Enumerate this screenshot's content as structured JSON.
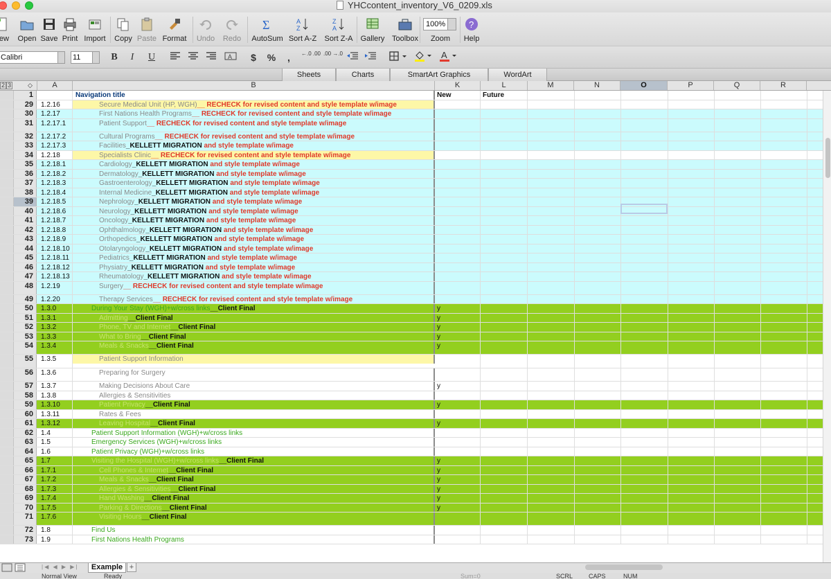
{
  "window": {
    "title": "YHCcontent_inventory_V6_0209.xls"
  },
  "toolbar": {
    "items": [
      {
        "label": "New",
        "icon": "new-doc-icon"
      },
      {
        "label": "Open",
        "icon": "open-folder-icon"
      },
      {
        "label": "Save",
        "icon": "save-icon"
      },
      {
        "label": "Print",
        "icon": "print-icon"
      },
      {
        "label": "Import",
        "icon": "import-icon"
      },
      {
        "label": "Copy",
        "icon": "copy-icon"
      },
      {
        "label": "Paste",
        "icon": "paste-icon"
      },
      {
        "label": "Format",
        "icon": "format-brush-icon"
      },
      {
        "label": "Undo",
        "icon": "undo-icon"
      },
      {
        "label": "Redo",
        "icon": "redo-icon"
      },
      {
        "label": "AutoSum",
        "icon": "sigma-icon"
      },
      {
        "label": "Sort A-Z",
        "icon": "sort-az-icon"
      },
      {
        "label": "Sort Z-A",
        "icon": "sort-za-icon"
      },
      {
        "label": "Gallery",
        "icon": "gallery-icon"
      },
      {
        "label": "Toolbox",
        "icon": "toolbox-icon"
      },
      {
        "label": "Zoom",
        "icon": "zoom-icon"
      },
      {
        "label": "Help",
        "icon": "help-icon"
      }
    ],
    "zoom_value": "100%"
  },
  "formatbar": {
    "font_name": "Calibri",
    "font_size": "11",
    "bold": "B",
    "italic": "I",
    "underline": "U",
    "currency": "$",
    "percent": "%",
    "comma": ",",
    "inc_decimal": "←.0 .00",
    "dec_decimal": ".00 →.0"
  },
  "ribbon": {
    "tabs": [
      "Sheets",
      "Charts",
      "SmartArt Graphics",
      "WordArt"
    ]
  },
  "columns": {
    "outline": [
      "2",
      "3"
    ],
    "letters": [
      "A",
      "B",
      "K",
      "L",
      "M",
      "N",
      "O",
      "P",
      "Q",
      "R"
    ],
    "selected": "O"
  },
  "rows": [
    {
      "n": "1",
      "a": "",
      "segs": [
        {
          "t": "Navigation title",
          "c": "bl"
        }
      ],
      "k": "New",
      "l": "Future",
      "hdr": true
    },
    {
      "n": "29",
      "a": "1.2.16",
      "segs": [
        {
          "t": "Secure Medical Unit (HP, WGH)",
          "c": "gray"
        },
        {
          "t": "__ RECHECK for revised content and style template w/image",
          "c": "red"
        }
      ],
      "k": "",
      "bg": "yellow"
    },
    {
      "n": "30",
      "a": "1.2.17",
      "segs": [
        {
          "t": "First Nations Health Programs",
          "c": "gray"
        },
        {
          "t": "__ RECHECK for revised content and style template w/image",
          "c": "red"
        }
      ],
      "k": "",
      "bg": "cyan"
    },
    {
      "n": "31",
      "a": "1.2.17.1",
      "segs": [
        {
          "t": "Patient Support",
          "c": "gray"
        },
        {
          "t": "__ RECHECK for revised content and style template w/image",
          "c": "red"
        }
      ],
      "k": "",
      "bg": "cyan"
    },
    {
      "n": "32",
      "a": "1.2.17.2",
      "segs": [
        {
          "t": "Cultural Programs",
          "c": "gray"
        },
        {
          "t": "__ RECHECK for revised content and style template w/image",
          "c": "red"
        }
      ],
      "k": "",
      "bg": "cyan"
    },
    {
      "n": "33",
      "a": "1.2.17.3",
      "segs": [
        {
          "t": "Facilities",
          "c": "gray"
        },
        {
          "t": "_KELLETT MIGRATION ",
          "c": "blk"
        },
        {
          "t": "and style template w/image",
          "c": "red"
        }
      ],
      "k": "",
      "bg": "cyan"
    },
    {
      "n": "34",
      "a": "1.2.18",
      "segs": [
        {
          "t": "Specialists Clinic",
          "c": "gray"
        },
        {
          "t": "__ RECHECK for revised content and style template w/image",
          "c": "red"
        }
      ],
      "k": "",
      "bg": "yellow"
    },
    {
      "n": "35",
      "a": "1.2.18.1",
      "segs": [
        {
          "t": "Cardiology",
          "c": "gray"
        },
        {
          "t": "_KELLETT MIGRATION ",
          "c": "blk"
        },
        {
          "t": "and style template w/image",
          "c": "red"
        }
      ],
      "k": "",
      "bg": "cyan"
    },
    {
      "n": "36",
      "a": "1.2.18.2",
      "segs": [
        {
          "t": "Dermatology",
          "c": "gray"
        },
        {
          "t": "_KELLETT MIGRATION ",
          "c": "blk"
        },
        {
          "t": "and style template w/image",
          "c": "red"
        }
      ],
      "k": "",
      "bg": "cyan"
    },
    {
      "n": "37",
      "a": "1.2.18.3",
      "segs": [
        {
          "t": "Gastroenterology",
          "c": "gray"
        },
        {
          "t": "_KELLETT MIGRATION ",
          "c": "blk"
        },
        {
          "t": "and style template w/image",
          "c": "red"
        }
      ],
      "k": "",
      "bg": "cyan"
    },
    {
      "n": "38",
      "a": "1.2.18.4",
      "segs": [
        {
          "t": "Internal Medicine",
          "c": "gray"
        },
        {
          "t": "_KELLETT MIGRATION ",
          "c": "blk"
        },
        {
          "t": "and style template w/image",
          "c": "red"
        }
      ],
      "k": "",
      "bg": "cyan"
    },
    {
      "n": "39",
      "a": "1.2.18.5",
      "segs": [
        {
          "t": "Nephrology",
          "c": "gray"
        },
        {
          "t": "_KELLETT MIGRATION ",
          "c": "blk"
        },
        {
          "t": "and style template w/image",
          "c": "red"
        }
      ],
      "k": "",
      "bg": "cyan",
      "sel": true
    },
    {
      "n": "40",
      "a": "1.2.18.6",
      "segs": [
        {
          "t": "Neurology",
          "c": "gray"
        },
        {
          "t": "_KELLETT MIGRATION ",
          "c": "blk"
        },
        {
          "t": "and style template w/image",
          "c": "red"
        }
      ],
      "k": "",
      "bg": "cyan"
    },
    {
      "n": "41",
      "a": "1.2.18.7",
      "segs": [
        {
          "t": "Oncology",
          "c": "gray"
        },
        {
          "t": "_KELLETT MIGRATION ",
          "c": "blk"
        },
        {
          "t": "and style template w/image",
          "c": "red"
        }
      ],
      "k": "",
      "bg": "cyan"
    },
    {
      "n": "42",
      "a": "1.2.18.8",
      "segs": [
        {
          "t": "Ophthalmology",
          "c": "gray"
        },
        {
          "t": "_KELLETT MIGRATION ",
          "c": "blk"
        },
        {
          "t": "and style template w/image",
          "c": "red"
        }
      ],
      "k": "",
      "bg": "cyan"
    },
    {
      "n": "43",
      "a": "1.2.18.9",
      "segs": [
        {
          "t": "Orthopedics",
          "c": "gray"
        },
        {
          "t": "_KELLETT MIGRATION ",
          "c": "blk"
        },
        {
          "t": "and style template w/image",
          "c": "red"
        }
      ],
      "k": "",
      "bg": "cyan"
    },
    {
      "n": "44",
      "a": "1.2.18.10",
      "segs": [
        {
          "t": "Otolaryngology",
          "c": "gray"
        },
        {
          "t": "_KELLETT MIGRATION ",
          "c": "blk"
        },
        {
          "t": "and style template w/image",
          "c": "red"
        }
      ],
      "k": "",
      "bg": "cyan"
    },
    {
      "n": "45",
      "a": "1.2.18.11",
      "segs": [
        {
          "t": "Pediatrics",
          "c": "gray"
        },
        {
          "t": "_KELLETT MIGRATION ",
          "c": "blk"
        },
        {
          "t": "and style template w/image",
          "c": "red"
        }
      ],
      "k": "",
      "bg": "cyan"
    },
    {
      "n": "46",
      "a": "1.2.18.12",
      "segs": [
        {
          "t": "Physiatry",
          "c": "gray"
        },
        {
          "t": "_KELLETT MIGRATION ",
          "c": "blk"
        },
        {
          "t": "and style template w/image",
          "c": "red"
        }
      ],
      "k": "",
      "bg": "cyan"
    },
    {
      "n": "47",
      "a": "1.2.18.13",
      "segs": [
        {
          "t": "Rheumatology",
          "c": "gray"
        },
        {
          "t": "_KELLETT MIGRATION ",
          "c": "blk"
        },
        {
          "t": "and style template w/image",
          "c": "red"
        }
      ],
      "k": "",
      "bg": "cyan"
    },
    {
      "n": "48",
      "a": "1.2.19",
      "segs": [
        {
          "t": "Surgery",
          "c": "gray"
        },
        {
          "t": "__ RECHECK for revised content and style template w/image",
          "c": "red"
        }
      ],
      "k": "",
      "bg": "cyan"
    },
    {
      "n": "49",
      "a": "1.2.20",
      "segs": [
        {
          "t": "Therapy Services",
          "c": "gray"
        },
        {
          "t": "__ RECHECK for revised content and style template w/image",
          "c": "red"
        }
      ],
      "k": "",
      "bg": "cyan"
    },
    {
      "n": "50",
      "a": "1.3.0",
      "segs": [
        {
          "t": "During Your Stay  (WGH)+w/cross links",
          "c": "grn"
        },
        {
          "t": "__Client Final",
          "c": "blk"
        }
      ],
      "k": "y",
      "bg": "green",
      "lvl": 2
    },
    {
      "n": "51",
      "a": "1.3.1",
      "segs": [
        {
          "t": "Admitting",
          "c": "lgrn"
        },
        {
          "t": "__Client Final",
          "c": "blk"
        }
      ],
      "k": "y",
      "bg": "green"
    },
    {
      "n": "52",
      "a": "1.3.2",
      "segs": [
        {
          "t": "Phone, TV and Internet",
          "c": "lgrn"
        },
        {
          "t": "__Client Final",
          "c": "blk"
        }
      ],
      "k": "y",
      "bg": "green"
    },
    {
      "n": "53",
      "a": "1.3.3",
      "segs": [
        {
          "t": "What to Bring",
          "c": "lgrn"
        },
        {
          "t": "__Client Final",
          "c": "blk"
        }
      ],
      "k": "y",
      "bg": "green"
    },
    {
      "n": "54",
      "a": "1.3.4",
      "segs": [
        {
          "t": "Meals & Snacks",
          "c": "lgrn"
        },
        {
          "t": "__Client Final",
          "c": "blk"
        }
      ],
      "k": "y",
      "bg": "green"
    },
    {
      "n": "55",
      "a": "1.3.5",
      "segs": [
        {
          "t": "Patient Support Information",
          "c": "gray"
        }
      ],
      "k": "",
      "bg": "yellowB"
    },
    {
      "n": "56",
      "a": "1.3.6",
      "segs": [
        {
          "t": "Preparing for Surgery",
          "c": "gray"
        }
      ],
      "k": "",
      "bg": "white"
    },
    {
      "n": "57",
      "a": "1.3.7",
      "segs": [
        {
          "t": "Making Decisions About Care",
          "c": "gray"
        }
      ],
      "k": "y",
      "bg": "white"
    },
    {
      "n": "58",
      "a": "1.3.8",
      "segs": [
        {
          "t": "Allergies & Sensitivities",
          "c": "gray"
        }
      ],
      "k": "",
      "bg": "white"
    },
    {
      "n": "59",
      "a": "1.3.10",
      "segs": [
        {
          "t": "Patient Privacy",
          "c": "lgrn"
        },
        {
          "t": "__Client Final",
          "c": "blk"
        }
      ],
      "k": "y",
      "bg": "green"
    },
    {
      "n": "60",
      "a": "1.3.11",
      "segs": [
        {
          "t": "Rates & Fees",
          "c": "gray"
        }
      ],
      "k": "",
      "bg": "white"
    },
    {
      "n": "61",
      "a": "1.3.12",
      "segs": [
        {
          "t": "Leaving Hospital",
          "c": "lgrn"
        },
        {
          "t": "__Client Final",
          "c": "blk"
        }
      ],
      "k": "y",
      "bg": "green"
    },
    {
      "n": "62",
      "a": "1.4",
      "segs": [
        {
          "t": "Patient Support Information  (WGH)+w/cross links",
          "c": "grn"
        }
      ],
      "k": "",
      "bg": "white",
      "lvl": 2
    },
    {
      "n": "63",
      "a": "1.5",
      "segs": [
        {
          "t": "Emergency Services  (WGH)+w/cross links",
          "c": "grn"
        }
      ],
      "k": "",
      "bg": "white",
      "lvl": 2
    },
    {
      "n": "64",
      "a": "1.6",
      "segs": [
        {
          "t": "Patient Privacy (WGH)+w/cross links",
          "c": "grn"
        }
      ],
      "k": "",
      "bg": "white",
      "lvl": 2
    },
    {
      "n": "65",
      "a": "1.7",
      "segs": [
        {
          "t": "Visiting the Hospital (WGH)+w/cross links",
          "c": "lgrn"
        },
        {
          "t": "__Client Final",
          "c": "blk"
        }
      ],
      "k": "y",
      "bg": "green",
      "lvl": 2
    },
    {
      "n": "66",
      "a": "1.7.1",
      "segs": [
        {
          "t": "Cell Phones & Internet",
          "c": "lgrn"
        },
        {
          "t": "__Client Final",
          "c": "blk"
        }
      ],
      "k": "y",
      "bg": "green"
    },
    {
      "n": "67",
      "a": "1.7.2",
      "segs": [
        {
          "t": "Meals & Snacks",
          "c": "lgrn"
        },
        {
          "t": "__Client Final",
          "c": "blk"
        }
      ],
      "k": "y",
      "bg": "green"
    },
    {
      "n": "68",
      "a": "1.7.3",
      "segs": [
        {
          "t": "Allergies & Sensitivities",
          "c": "lgrn"
        },
        {
          "t": "__Client Final",
          "c": "blk"
        }
      ],
      "k": "y",
      "bg": "green"
    },
    {
      "n": "69",
      "a": "1.7.4",
      "segs": [
        {
          "t": "Hand Washing",
          "c": "lgrn"
        },
        {
          "t": "__Client Final",
          "c": "blk"
        }
      ],
      "k": "y",
      "bg": "green"
    },
    {
      "n": "70",
      "a": "1.7.5",
      "segs": [
        {
          "t": "Parking & Directions",
          "c": "lgrn"
        },
        {
          "t": "__Client Final",
          "c": "blk"
        }
      ],
      "k": "y",
      "bg": "green"
    },
    {
      "n": "71",
      "a": "1.7.6",
      "segs": [
        {
          "t": "Visiting Hours",
          "c": "lgrn"
        },
        {
          "t": "__Client Final",
          "c": "blk"
        }
      ],
      "k": "",
      "bg": "green"
    },
    {
      "n": "72",
      "a": "1.8",
      "segs": [
        {
          "t": "Find Us",
          "c": "grn"
        }
      ],
      "k": "",
      "bg": "white",
      "lvl": 2
    },
    {
      "n": "73",
      "a": "1.9",
      "segs": [
        {
          "t": "First Nations Health Programs",
          "c": "grn"
        }
      ],
      "k": "",
      "bg": "white",
      "lvl": 2
    }
  ],
  "sheet": {
    "tab": "Example",
    "add": "+",
    "status_left": "Ready",
    "status_sum": "Sum=0",
    "status_flags": [
      "SCRL",
      "CAPS",
      "NUM"
    ],
    "view_label": "Normal View"
  },
  "colors": {
    "cyan": "#cbfbfd",
    "yellow": "#fdf7a7",
    "green": "#93cf1f",
    "accent": "#2a66c9"
  }
}
